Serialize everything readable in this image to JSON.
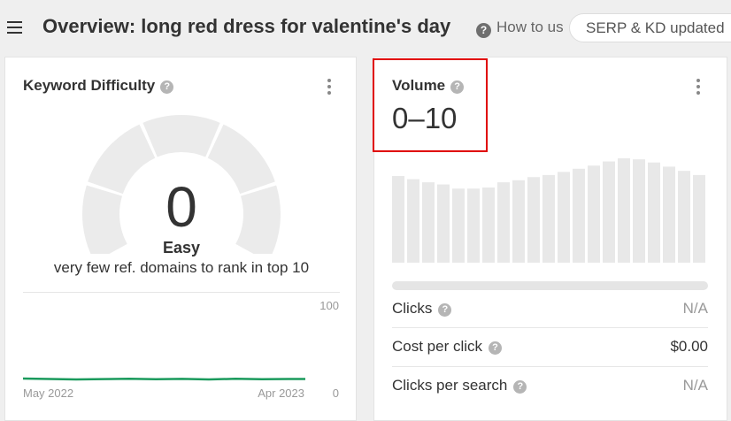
{
  "header": {
    "title": "Overview: long red dress for valentine's day",
    "howto_label": "How to us",
    "serp_pill": "SERP & KD updated"
  },
  "keyword_difficulty": {
    "title": "Keyword Difficulty",
    "value": "0",
    "label": "Easy",
    "description": "very few ref. domains to rank in top 10",
    "chart": {
      "y_max_label": "100",
      "y_min_label": "0",
      "x_start_label": "May 2022",
      "x_end_label": "Apr 2023",
      "line_color": "#1a9a5c"
    }
  },
  "volume": {
    "title": "Volume",
    "value": "0–10",
    "trend_bar_count": 21,
    "progress": 0,
    "metrics": [
      {
        "label": "Clicks",
        "value": "N/A",
        "help": true
      },
      {
        "label": "Cost per click",
        "value": "$0.00",
        "help": true
      },
      {
        "label": "Clicks per search",
        "value": "N/A",
        "help": true
      }
    ]
  },
  "icons": {
    "menu": "hamburger-icon",
    "help": "question-circle-icon",
    "more": "vertical-dots-icon"
  },
  "colors": {
    "highlight_box": "#e00000",
    "gauge_gray": "#ebebeb",
    "bar_gray": "#e8e8e8"
  }
}
